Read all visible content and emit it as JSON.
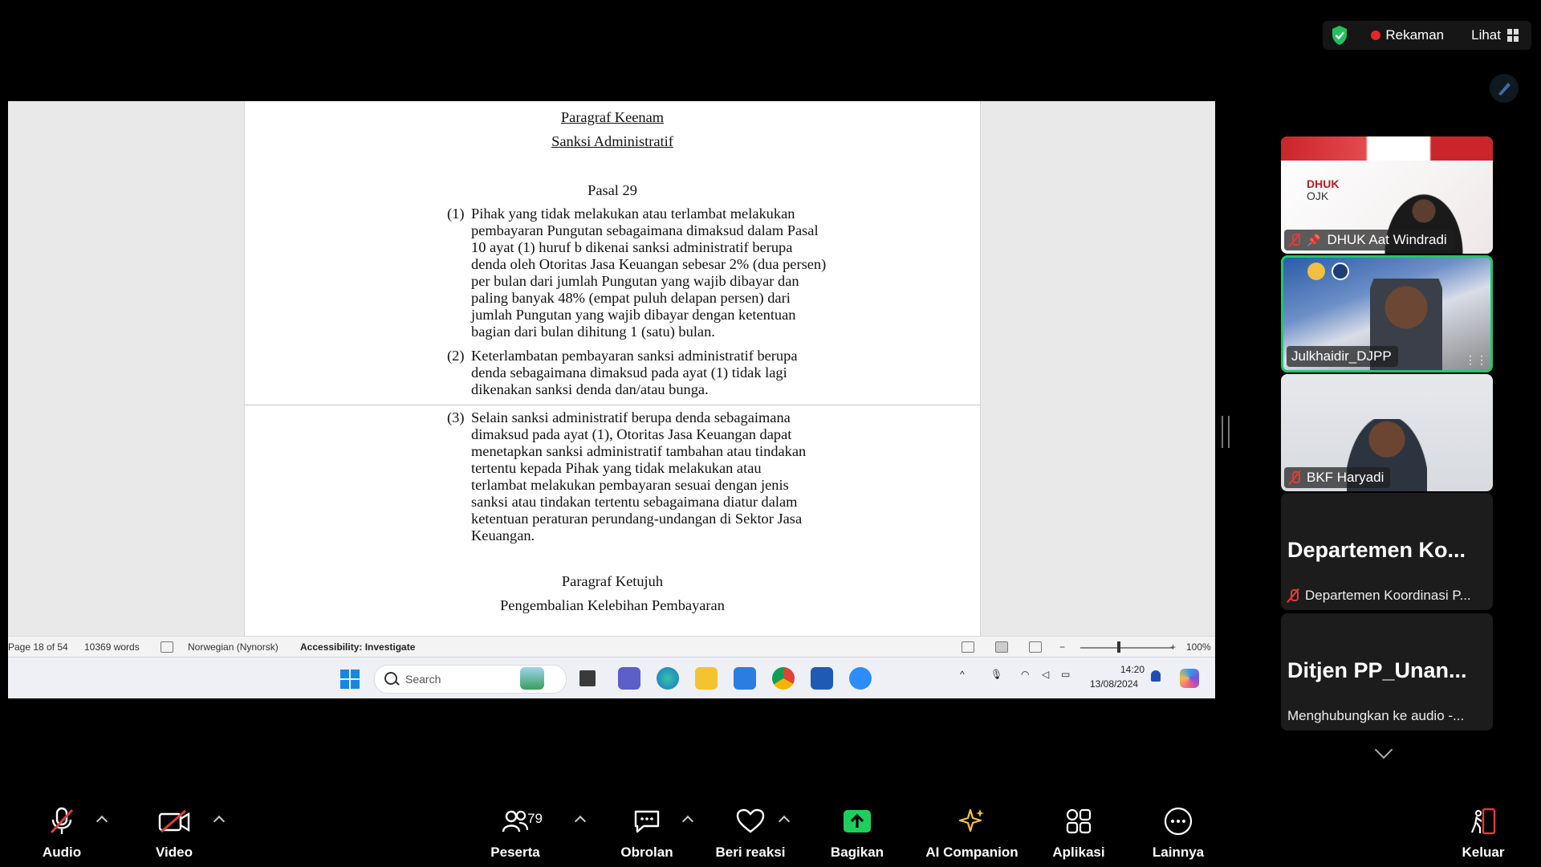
{
  "top": {
    "recording_label": "Rekaman",
    "view_label": "Lihat"
  },
  "document": {
    "heading1": "Paragraf Keenam",
    "heading2": "Sanksi Administratif",
    "article": "Pasal 29",
    "items": [
      {
        "num": "(1)",
        "lines": [
          "Pihak yang tidak melakukan atau terlambat melakukan",
          "pembayaran Pungutan sebagaimana dimaksud dalam Pasal",
          "10 ayat (1) huruf b dikenai sanksi administratif berupa",
          "denda oleh Otoritas Jasa Keuangan sebesar 2% (dua persen)",
          "per bulan dari jumlah Pungutan yang wajib dibayar dan",
          "paling banyak 48% (empat puluh delapan persen) dari",
          "jumlah Pungutan yang wajib dibayar dengan ketentuan",
          "bagian dari bulan dihitung 1 (satu) bulan."
        ]
      },
      {
        "num": "(2)",
        "lines": [
          "Keterlambatan pembayaran sanksi administratif berupa",
          "denda sebagaimana dimaksud pada ayat (1) tidak lagi",
          "dikenakan sanksi denda dan/atau bunga."
        ]
      },
      {
        "num": "(3)",
        "lines": [
          "Selain sanksi administratif berupa denda sebagaimana",
          "dimaksud pada ayat (1), Otoritas Jasa Keuangan dapat",
          "menetapkan sanksi administratif tambahan atau tindakan",
          "tertentu kepada Pihak yang tidak melakukan atau",
          "terlambat melakukan pembayaran sesuai dengan jenis",
          "sanksi atau tindakan tertentu sebagaimana diatur dalam",
          "ketentuan peraturan perundang-undangan di Sektor Jasa",
          "Keuangan."
        ]
      }
    ],
    "heading3": "Paragraf Ketujuh",
    "heading4": "Pengembalian Kelebihan Pembayaran"
  },
  "word_status": {
    "page": "Page 18 of 54",
    "words": "10369 words",
    "language": "Norwegian (Nynorsk)",
    "accessibility": "Accessibility: Investigate",
    "zoom": "100%"
  },
  "taskbar": {
    "search_placeholder": "Search",
    "time": "14:20",
    "date": "13/08/2024"
  },
  "participants": [
    {
      "name": "DHUK Aat Windradi",
      "muted": true,
      "pinned": true,
      "tile_text": "DHUK\nOJK"
    },
    {
      "name": "Julkhaidir_DJPP",
      "muted": false,
      "speaking": true
    },
    {
      "name": "BKF Haryadi",
      "muted": true
    }
  ],
  "name_tiles": [
    {
      "display": "Departemen  Ko...",
      "subtitle": "Departemen Koordinasi P...",
      "muted": true
    },
    {
      "display": "Ditjen PP_Unan...",
      "subtitle": "Menghubungkan ke audio -..."
    }
  ],
  "toolbar": {
    "audio": "Audio",
    "video": "Video",
    "participants": "Peserta",
    "participants_count": "79",
    "chat": "Obrolan",
    "react": "Beri reaksi",
    "share": "Bagikan",
    "ai": "AI Companion",
    "apps": "Aplikasi",
    "more": "Lainnya",
    "leave": "Keluar"
  },
  "colors": {
    "accent_green": "#26c46b",
    "share_green": "#1fcf5b",
    "record_red": "#e02828",
    "mute_red": "#e23b3b"
  }
}
